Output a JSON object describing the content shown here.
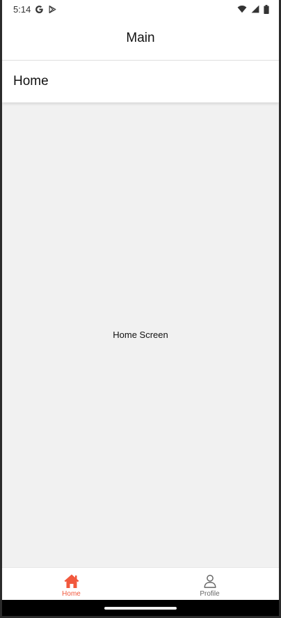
{
  "status_bar": {
    "time": "5:14",
    "left_icons": [
      "google-g-icon",
      "play-store-icon"
    ],
    "right_icons": [
      "wifi-icon",
      "signal-icon",
      "battery-icon"
    ]
  },
  "header": {
    "title": "Main"
  },
  "subheader": {
    "title": "Home"
  },
  "content": {
    "text": "Home Screen"
  },
  "tabs": [
    {
      "label": "Home",
      "icon": "home-icon",
      "active": true
    },
    {
      "label": "Profile",
      "icon": "person-icon",
      "active": false
    }
  ],
  "colors": {
    "accent": "#f1583d",
    "inactive": "#666666",
    "background": "#f1f1f1",
    "surface": "#ffffff"
  }
}
